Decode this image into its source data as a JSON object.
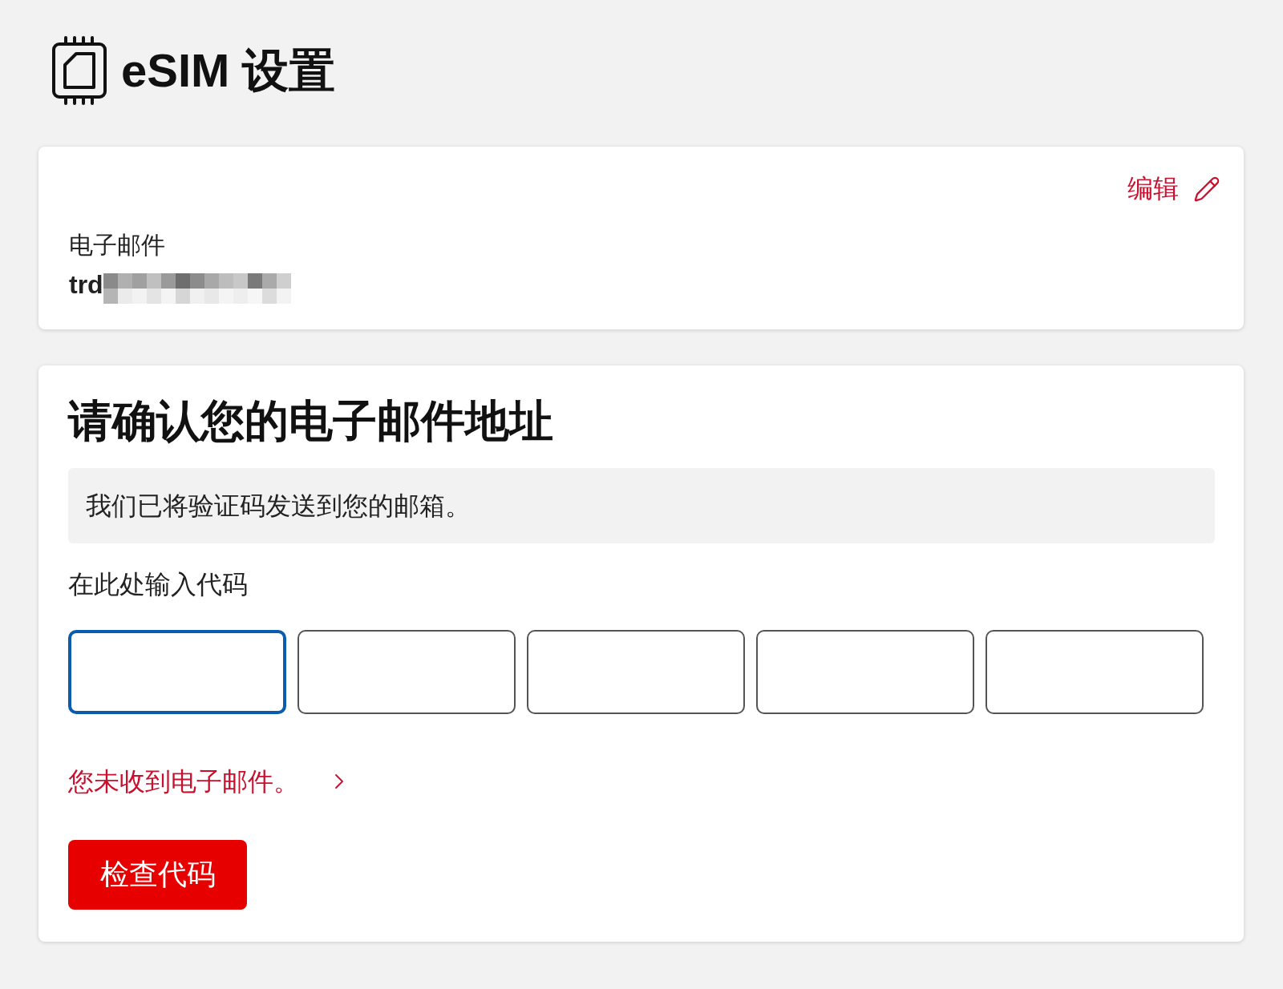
{
  "header": {
    "title": "eSIM 设置"
  },
  "account_card": {
    "edit_label": "编辑",
    "email_label": "电子邮件",
    "email_value": "trd",
    "email_redacted": true
  },
  "verify_card": {
    "heading": "请确认您的电子邮件地址",
    "notice": "我们已将验证码发送到您的邮箱。",
    "code_label": "在此处输入代码",
    "code_fields": [
      {
        "focused": true
      },
      {
        "focused": false
      },
      {
        "focused": false
      },
      {
        "focused": false
      },
      {
        "focused": false
      }
    ],
    "resend_link": "您未收到电子邮件。",
    "submit_button": "检查代码"
  }
}
